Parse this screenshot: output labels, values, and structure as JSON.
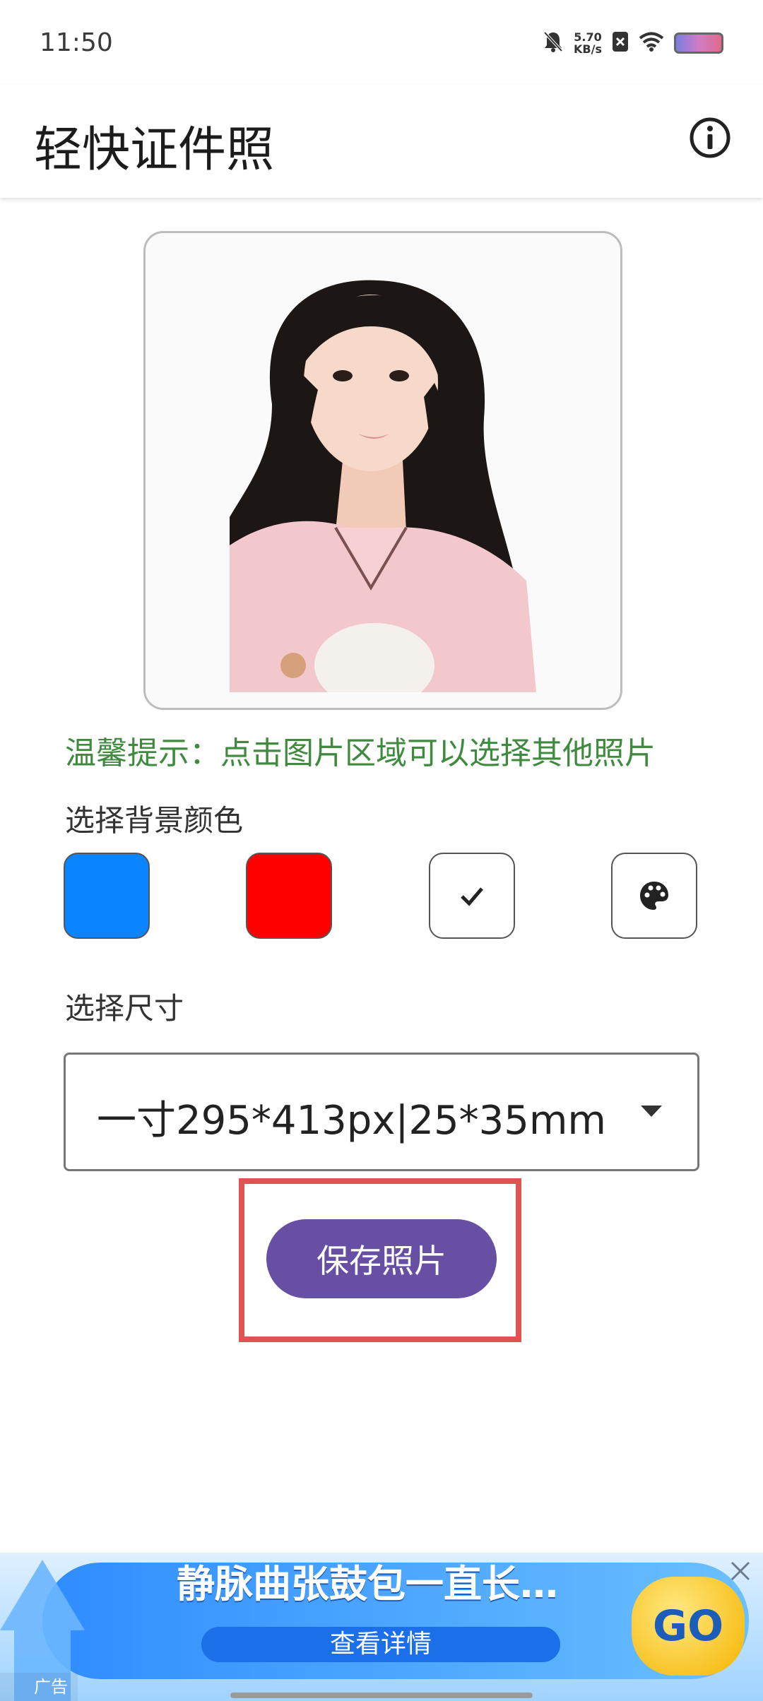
{
  "status_bar": {
    "time": "11:50",
    "net_speed_value": "5.70",
    "net_speed_unit": "KB/s",
    "icons": [
      "bell-muted-icon",
      "sim-off-icon",
      "wifi-icon",
      "battery-icon"
    ]
  },
  "app_bar": {
    "title": "轻快证件照",
    "info_icon": "info-icon"
  },
  "photo": {
    "description_icon": "portrait-photo"
  },
  "tip": "温馨提示：点击图片区域可以选择其他照片",
  "background_section": {
    "label": "选择背景颜色",
    "swatches": [
      {
        "name": "blue",
        "color": "#0a84ff",
        "selected": false
      },
      {
        "name": "red",
        "color": "#ff0000",
        "selected": false
      },
      {
        "name": "white",
        "color": "#ffffff",
        "selected": true
      },
      {
        "name": "custom",
        "color": "#ffffff",
        "icon": "palette-icon",
        "selected": false
      }
    ]
  },
  "size_section": {
    "label": "选择尺寸",
    "selected_value": "一寸295*413px|25*35mm"
  },
  "save_button": {
    "label": "保存照片",
    "color": "#6750a4"
  },
  "ad_banner": {
    "title": "静脉曲张鼓包一直长…",
    "subtitle": "查看详情",
    "go_label": "GO",
    "tag": "广告"
  },
  "colors": {
    "accent": "#6750a4",
    "tip_green": "#3f8a3f",
    "highlight_red": "#e05353"
  }
}
